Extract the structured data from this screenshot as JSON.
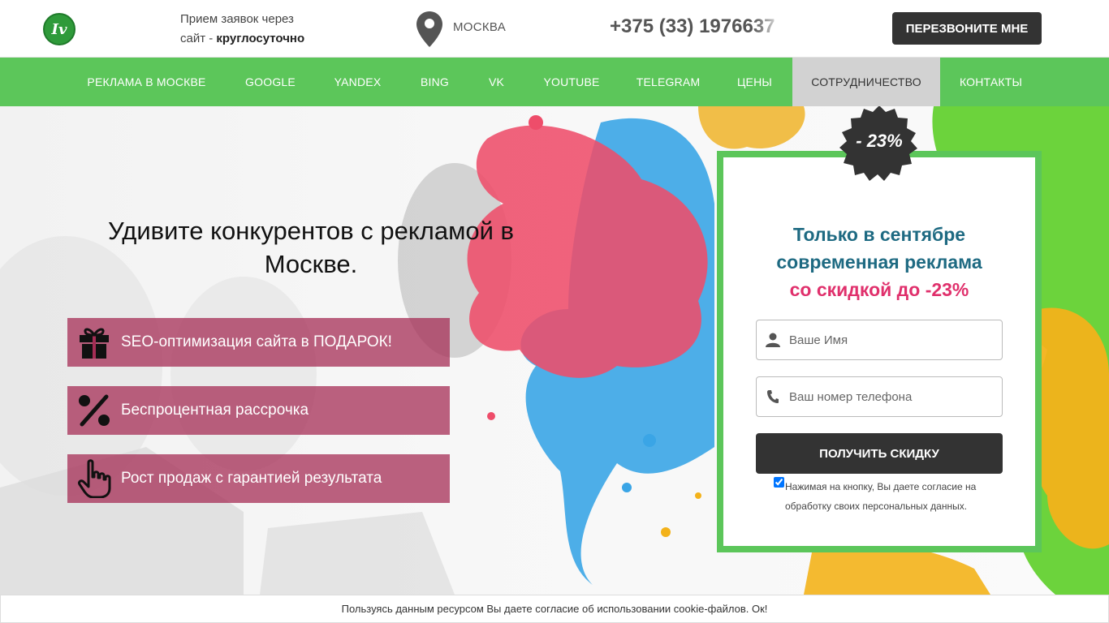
{
  "header": {
    "logo_text": "Iv",
    "hours_line1": "Прием заявок через",
    "hours_line2_prefix": "сайт - ",
    "hours_line2_bold": "круглосуточно",
    "city": "МОСКВА",
    "phone": "+375 (33) 1976637",
    "callback_label": "ПЕРЕЗВОНИТЕ МНЕ"
  },
  "nav": {
    "items": [
      {
        "label": "РЕКЛАМА В МОСКВЕ"
      },
      {
        "label": "GOOGLE"
      },
      {
        "label": "YANDEX"
      },
      {
        "label": "BING"
      },
      {
        "label": "VK"
      },
      {
        "label": "YOUTUBE"
      },
      {
        "label": "TELEGRAM"
      },
      {
        "label": "ЦЕНЫ"
      },
      {
        "label": "СОТРУДНИЧЕСТВО",
        "active": true
      },
      {
        "label": "КОНТАКТЫ"
      }
    ]
  },
  "hero": {
    "title": "Удивите конкурентов с рекламой в Москве.",
    "features": [
      {
        "icon": "gift-icon",
        "label": "SEO-оптимизация сайта в ПОДАРОК!"
      },
      {
        "icon": "percent-icon",
        "label": "Беспроцентная рассрочка"
      },
      {
        "icon": "pointing-hand-icon",
        "label": "Рост продаж с гарантией результата"
      }
    ]
  },
  "form": {
    "badge": "- 23%",
    "offer_line1": "Только в сентябре",
    "offer_line2": "современная реклама",
    "offer_line3": "со скидкой до -23%",
    "name_placeholder": "Ваше Имя",
    "phone_placeholder": "Ваш номер телефона",
    "submit_label": "ПОЛУЧИТЬ СКИДКУ",
    "consent_text": "Нажимая на кнопку, Вы даете согласие на обработку своих персональных данных.",
    "consent_checked": true
  },
  "cookie_bar": {
    "text": "Пользуясь данным ресурсом Вы даете согласие об использовании cookie-файлов. Ок!"
  },
  "colors": {
    "brand_green": "#5cc65a",
    "feature_bg": "#a52d55",
    "offer_blue": "#1e6a82",
    "offer_pink": "#e0306c",
    "dark_button": "#333333"
  }
}
